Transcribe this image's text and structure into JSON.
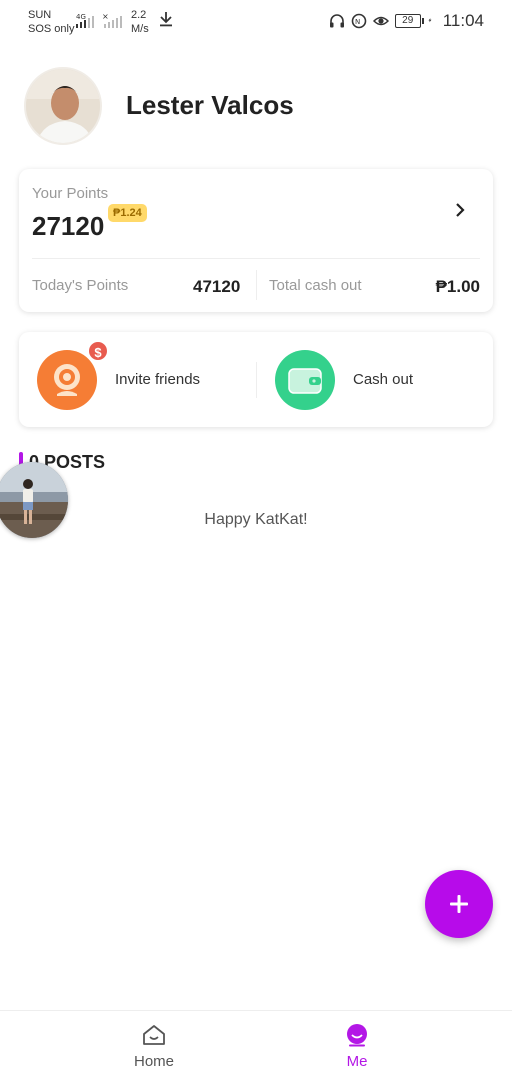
{
  "status_bar": {
    "carrier_line1": "SUN",
    "carrier_line2": "SOS only",
    "speed_line1": "2.2",
    "speed_line2": "M/s",
    "battery_level": "29",
    "time": "11:04"
  },
  "profile": {
    "name": "Lester Valcos"
  },
  "points_card": {
    "your_points_label": "Your Points",
    "your_points_value": "27120",
    "peso_badge": "₱1.24",
    "todays_points_label": "Today's Points",
    "todays_points_value": "47120",
    "total_cashout_label": "Total cash out",
    "total_cashout_value": "₱1.00"
  },
  "actions": {
    "invite_label": "Invite friends",
    "invite_badge": "$",
    "cashout_label": "Cash out"
  },
  "posts": {
    "title": "0 POSTS",
    "empty_message": "Happy KatKat!"
  },
  "bottom_nav": {
    "home_label": "Home",
    "me_label": "Me"
  },
  "colors": {
    "accent_purple": "#b70bea",
    "invite_orange": "#f57d35",
    "cash_green": "#34d18c",
    "badge_yellow": "#ffd96a"
  },
  "icons": [
    "download-icon",
    "headphones-icon",
    "data-saver-icon",
    "eye-icon",
    "battery-icon",
    "chevron-right-icon",
    "webcam-icon",
    "wallet-icon",
    "plus-icon",
    "home-icon",
    "me-icon"
  ]
}
